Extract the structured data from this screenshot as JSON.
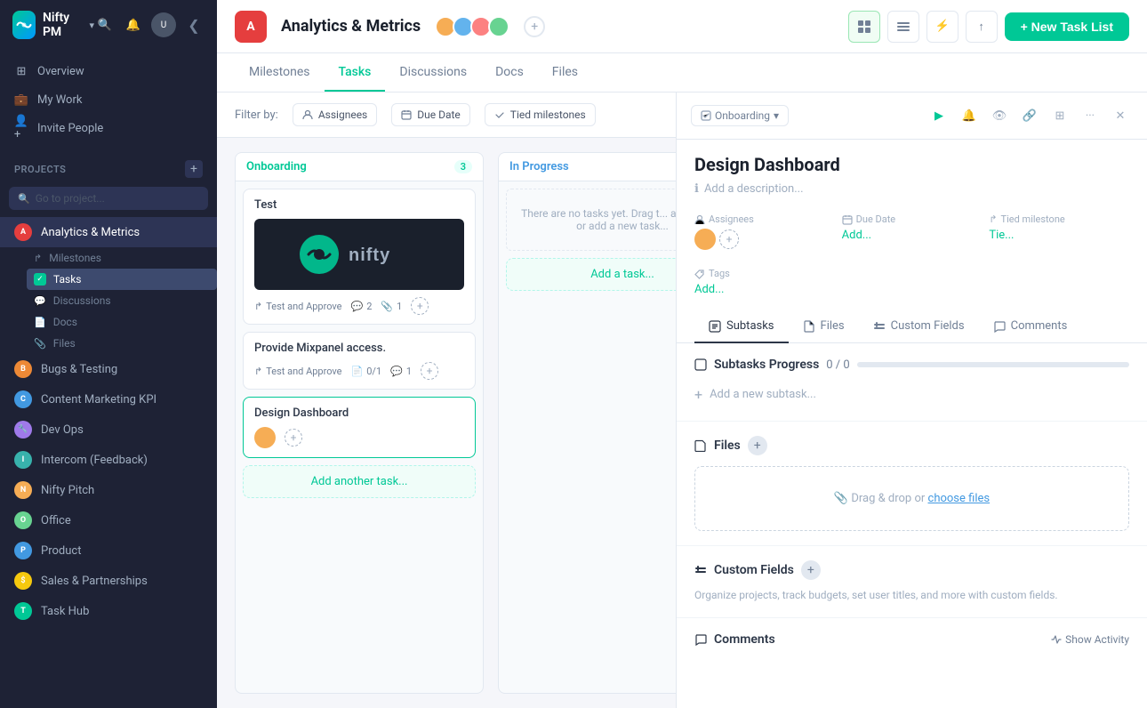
{
  "app": {
    "name": "Nifty PM",
    "name_suffix": "▾"
  },
  "sidebar": {
    "nav_items": [
      {
        "id": "overview",
        "label": "Overview",
        "icon": "grid"
      },
      {
        "id": "my-work",
        "label": "My Work",
        "icon": "briefcase"
      },
      {
        "id": "invite",
        "label": "Invite People",
        "icon": "user-plus"
      }
    ],
    "projects_label": "PROJECTS",
    "search_placeholder": "Go to project...",
    "projects": [
      {
        "id": "analytics",
        "label": "Analytics & Metrics",
        "color": "#e53e3e",
        "active": true
      },
      {
        "id": "bugs",
        "label": "Bugs & Testing",
        "color": "#ed8936"
      },
      {
        "id": "content",
        "label": "Content Marketing KPI",
        "color": "#4299e1"
      },
      {
        "id": "devops",
        "label": "Dev Ops",
        "color": "#9f7aea"
      },
      {
        "id": "intercom",
        "label": "Intercom (Feedback)",
        "color": "#38b2ac"
      },
      {
        "id": "pitch",
        "label": "Nifty Pitch",
        "color": "#f6ad55"
      },
      {
        "id": "office",
        "label": "Office",
        "color": "#68d391"
      },
      {
        "id": "product",
        "label": "Product",
        "color": "#4299e1"
      },
      {
        "id": "sales",
        "label": "Sales & Partnerships",
        "color": "#f6c90e"
      },
      {
        "id": "taskhub",
        "label": "Task Hub",
        "color": "#00c896"
      }
    ],
    "sub_items": [
      {
        "id": "milestones",
        "label": "Milestones",
        "icon": "arrow"
      },
      {
        "id": "tasks",
        "label": "Tasks",
        "icon": "check",
        "active": true
      },
      {
        "id": "discussions",
        "label": "Discussions",
        "icon": "chat"
      },
      {
        "id": "docs",
        "label": "Docs",
        "icon": "doc"
      },
      {
        "id": "files",
        "label": "Files",
        "icon": "clip"
      }
    ]
  },
  "topbar": {
    "project_initial": "A",
    "project_name": "Analytics & Metrics",
    "tabs": [
      "Milestones",
      "Tasks",
      "Discussions",
      "Docs",
      "Files"
    ],
    "active_tab": "Tasks",
    "new_task_btn": "+ New Task List"
  },
  "filter": {
    "label": "Filter by:",
    "buttons": [
      "Assignees",
      "Due Date",
      "Tied milestones"
    ]
  },
  "board": {
    "columns": [
      {
        "id": "onboarding",
        "title": "Onboarding",
        "count": 3,
        "color": "teal",
        "cards": [
          {
            "id": "test",
            "title": "Test",
            "has_image": true,
            "meta_text": "Test and Approve",
            "comments": 2,
            "attachments": 1
          },
          {
            "id": "mixpanel",
            "title": "Provide  Mixpanel access.",
            "meta_text": "Test and Approve",
            "doc_count": "0/1",
            "comments": 1
          },
          {
            "id": "design-dashboard",
            "title": "Design Dashboard",
            "active": true
          }
        ],
        "add_label": "Add another task..."
      },
      {
        "id": "in-progress",
        "title": "In Progress",
        "count": null,
        "color": "blue",
        "empty_text": "There are no tasks yet. Drag t... another list or add a new task...",
        "add_label": "Add a task..."
      }
    ]
  },
  "task_detail": {
    "status": "Onboarding",
    "title": "Design Dashboard",
    "description_placeholder": "Add a description...",
    "assignees_label": "Assignees",
    "due_date_label": "Due Date",
    "tied_milestone_label": "Tied milestone",
    "due_date_value": "Add...",
    "tied_milestone_value": "Tie...",
    "tags_label": "Tags",
    "tags_add": "Add...",
    "tabs": [
      "Subtasks",
      "Files",
      "Custom Fields",
      "Comments"
    ],
    "active_tab": "Subtasks",
    "subtasks_progress_label": "Subtasks Progress",
    "subtasks_progress": "0 / 0",
    "add_subtask_label": "Add a new subtask...",
    "files_label": "Files",
    "drop_label": "Drag & drop or",
    "choose_files_label": "choose files",
    "custom_fields_label": "Custom Fields",
    "custom_fields_desc": "Organize projects, track budgets, set user titles, and more with custom fields.",
    "comments_label": "Comments",
    "show_activity_label": "Show Activity"
  }
}
